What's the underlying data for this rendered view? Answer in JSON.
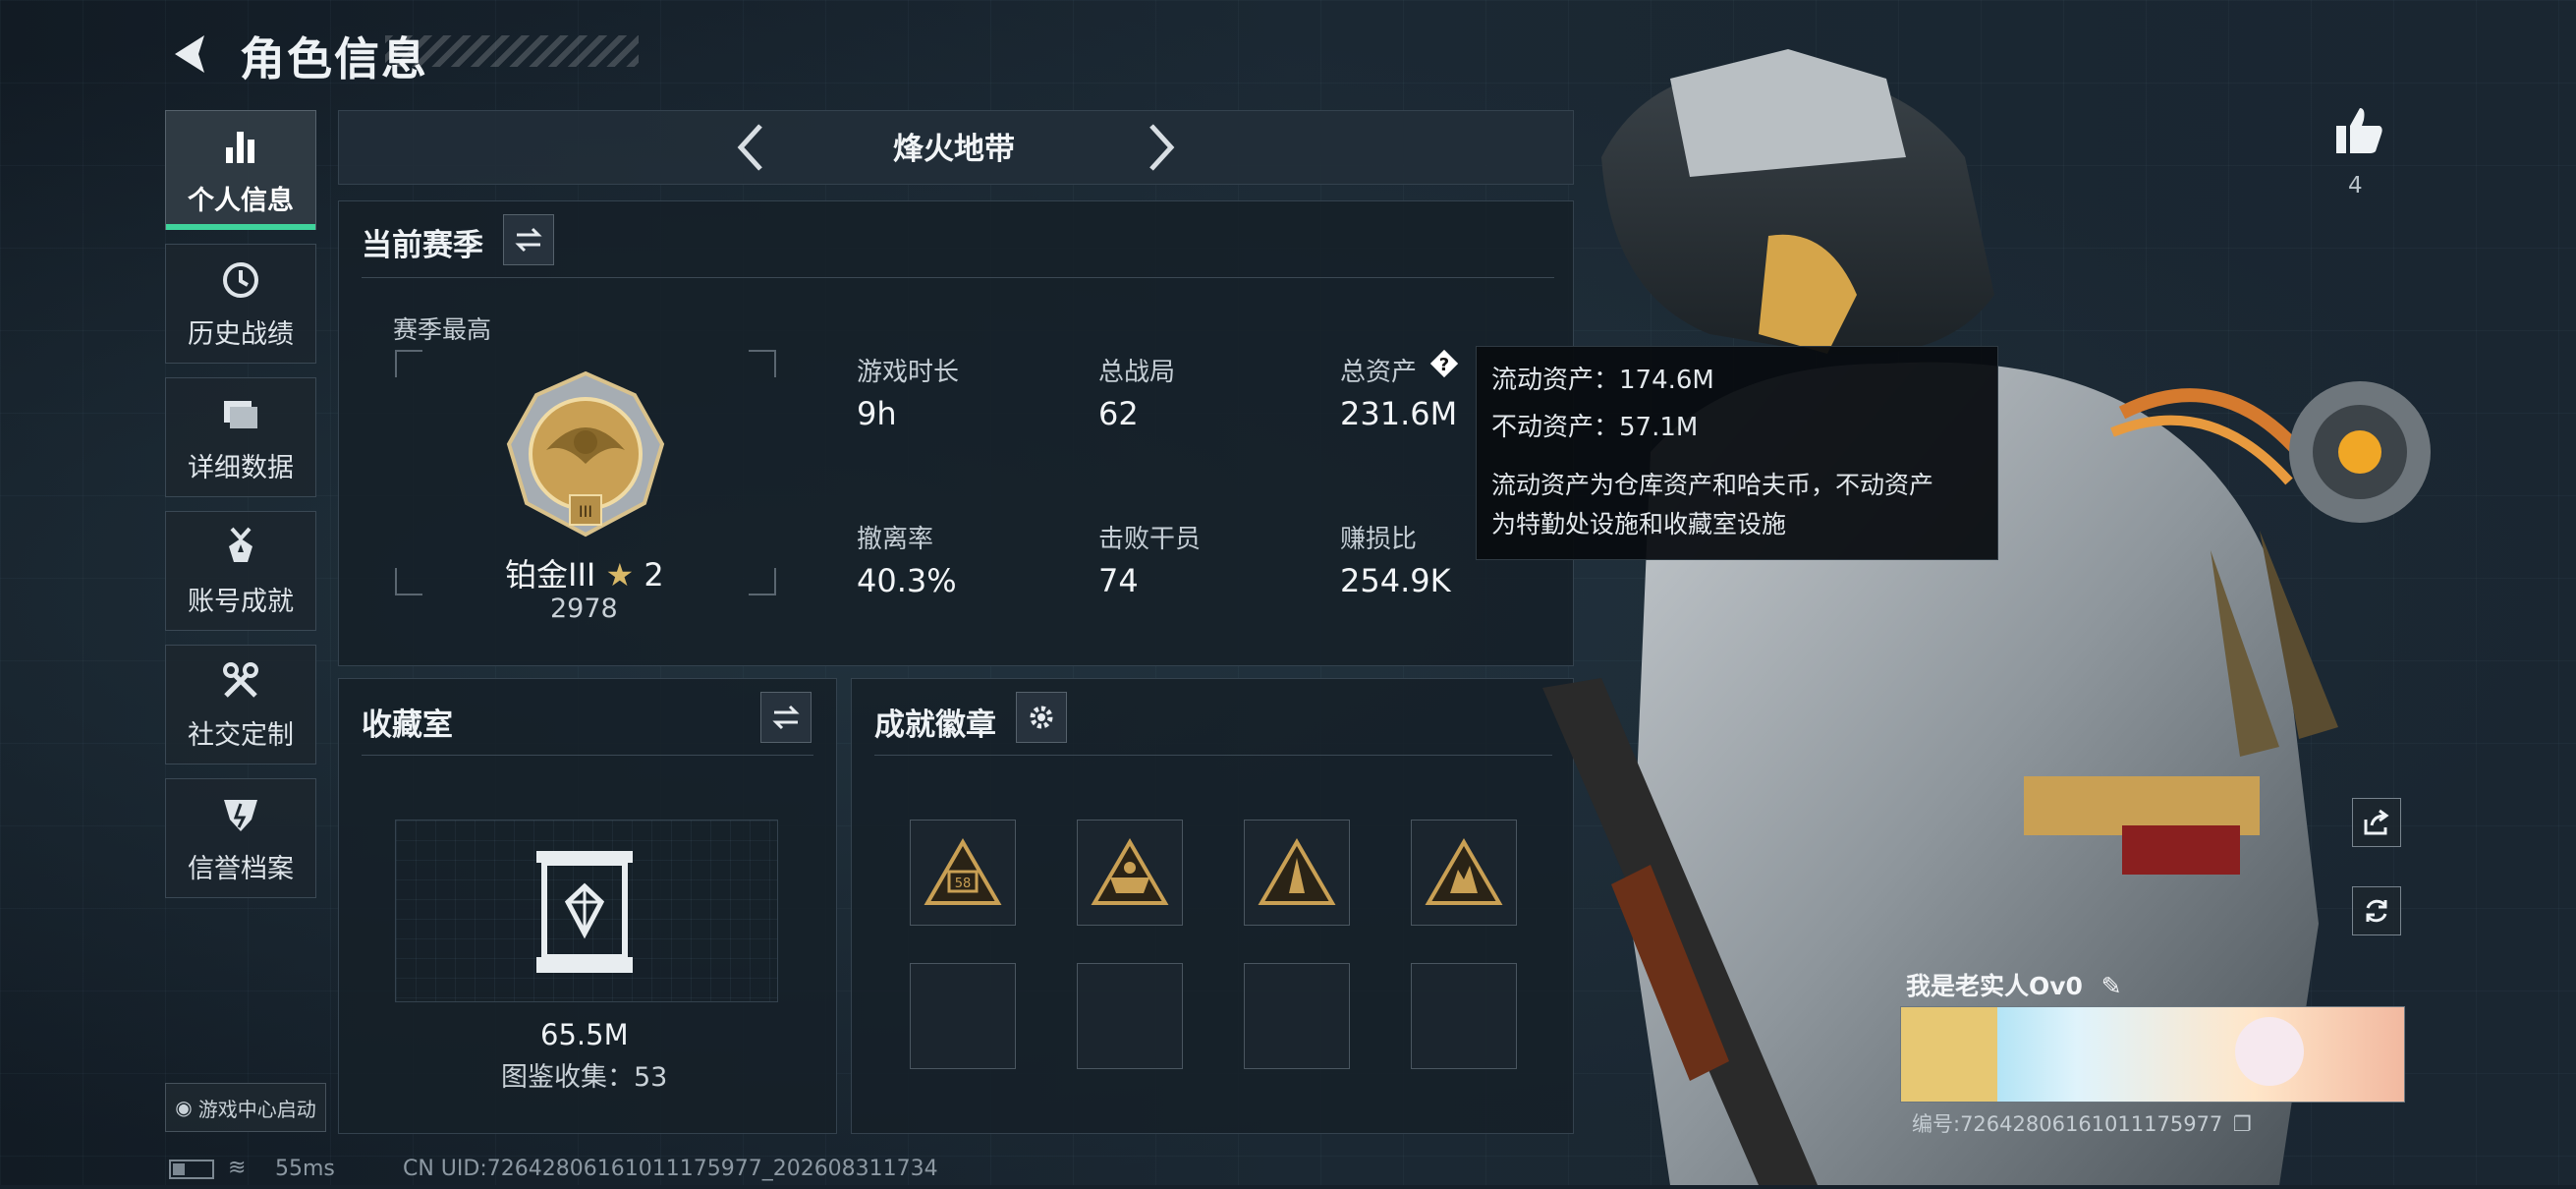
{
  "header": {
    "title": "角色信息"
  },
  "nav": {
    "items": [
      {
        "label": "个人信息",
        "icon": "bar-chart-icon",
        "active": true
      },
      {
        "label": "历史战绩",
        "icon": "history-icon",
        "active": false
      },
      {
        "label": "详细数据",
        "icon": "folder-icon",
        "active": false
      },
      {
        "label": "账号成就",
        "icon": "medal-icon",
        "active": false
      },
      {
        "label": "社交定制",
        "icon": "tools-icon",
        "active": false
      },
      {
        "label": "信誉档案",
        "icon": "shield-icon",
        "active": false
      }
    ],
    "launch_label": "游戏中心启动"
  },
  "mode": {
    "name": "烽火地带"
  },
  "season": {
    "title": "当前赛季",
    "best_label": "赛季最高",
    "rank_name": "铂金III",
    "rank_stars": "2",
    "rank_score": "2978",
    "rank_badge_numeral": "III",
    "stats": [
      {
        "label": "游戏时长",
        "value": "9h"
      },
      {
        "label": "总战局",
        "value": "62"
      },
      {
        "label": "总资产",
        "value": "231.6M"
      },
      {
        "label": "撤离率",
        "value": "40.3%"
      },
      {
        "label": "击败干员",
        "value": "74"
      },
      {
        "label": "赚损比",
        "value": "254.9K"
      }
    ]
  },
  "tooltip": {
    "line1": "流动资产：174.6M",
    "line2": "不动资产：57.1M",
    "desc1": "流动资产为仓库资产和哈夫币，不动资产",
    "desc2": "为特勤处设施和收藏室设施"
  },
  "collection": {
    "title": "收藏室",
    "value": "65.5M",
    "catalog": "图鉴收集：53"
  },
  "achievements": {
    "title": "成就徽章",
    "badge_text": "58"
  },
  "likes": {
    "count": "4"
  },
  "card": {
    "name": "我是老实人Ov0",
    "id": "编号:72642806161011175977"
  },
  "status": {
    "ping": "55ms",
    "uid": "CN UID:72642806161011175977_202608311734"
  },
  "colors": {
    "accent": "#3fd49c",
    "gold": "#c9a054",
    "panel": "#16202a"
  }
}
